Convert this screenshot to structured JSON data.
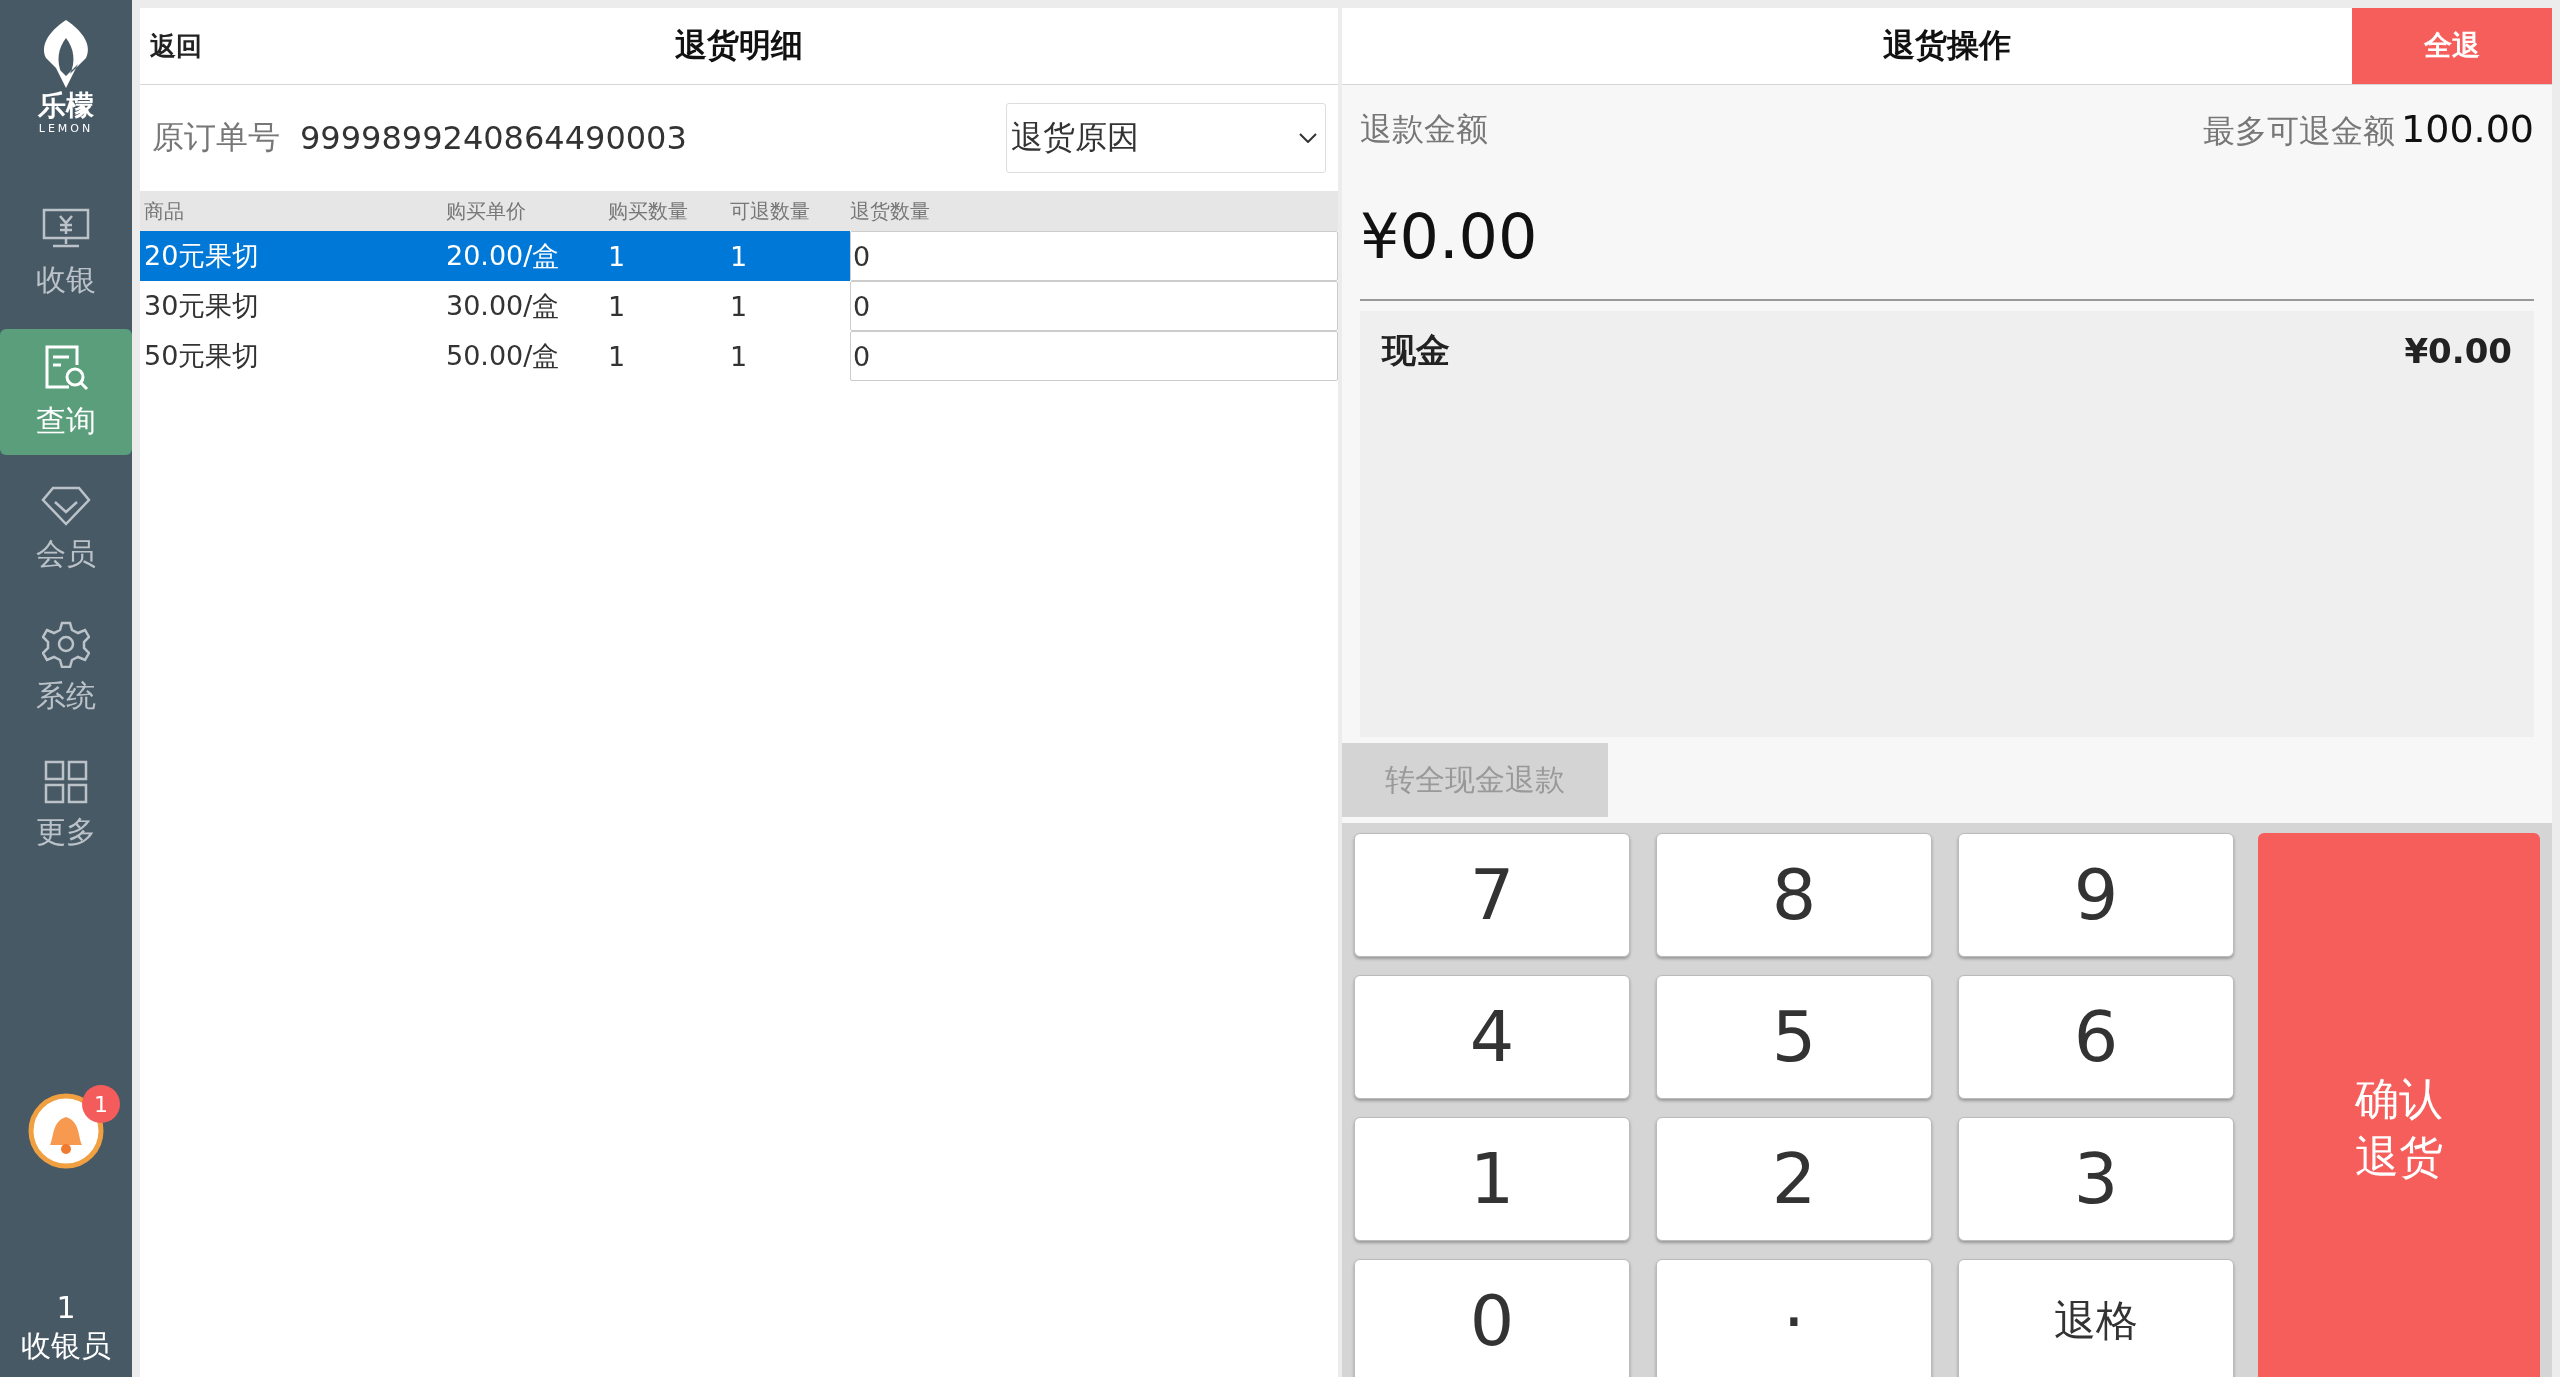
{
  "sidebar": {
    "logo": {
      "name": "乐檬",
      "sub": "LEMON"
    },
    "items": [
      {
        "label": "收银",
        "kind": "register",
        "selected": false
      },
      {
        "label": "查询",
        "kind": "query",
        "selected": true
      },
      {
        "label": "会员",
        "kind": "member",
        "selected": false
      },
      {
        "label": "系统",
        "kind": "system",
        "selected": false
      },
      {
        "label": "更多",
        "kind": "more",
        "selected": false
      }
    ],
    "notification": {
      "count": "1"
    },
    "user": {
      "id": "1",
      "role": "收银员"
    }
  },
  "detail": {
    "back": "返回",
    "title": "退货明细",
    "order_label": "原订单号",
    "order_number": "9999899240864490003",
    "reason": {
      "placeholder": "退货原因"
    },
    "columns": [
      "商品",
      "购买单价",
      "购买数量",
      "可退数量",
      "退货数量"
    ],
    "rows": [
      {
        "name": "20元果切",
        "price": "20.00/盒",
        "qty": "1",
        "returnable": "1",
        "return_qty": "0",
        "selected": true
      },
      {
        "name": "30元果切",
        "price": "30.00/盒",
        "qty": "1",
        "returnable": "1",
        "return_qty": "0",
        "selected": false
      },
      {
        "name": "50元果切",
        "price": "50.00/盒",
        "qty": "1",
        "returnable": "1",
        "return_qty": "0",
        "selected": false
      }
    ]
  },
  "operation": {
    "title": "退货操作",
    "all_button": "全退",
    "refund_label": "退款金额",
    "max_label": "最多可退金额",
    "max_value": "100.00",
    "amount": "¥0.00",
    "payments": [
      {
        "method": "现金",
        "amount": "¥0.00"
      }
    ],
    "convert_button": {
      "label": "转全现金退款",
      "disabled": true
    },
    "keys": [
      {
        "label": "7",
        "kind": "digit"
      },
      {
        "label": "8",
        "kind": "digit"
      },
      {
        "label": "9",
        "kind": "digit"
      },
      {
        "label": "4",
        "kind": "digit"
      },
      {
        "label": "5",
        "kind": "digit"
      },
      {
        "label": "6",
        "kind": "digit"
      },
      {
        "label": "1",
        "kind": "digit"
      },
      {
        "label": "2",
        "kind": "digit"
      },
      {
        "label": "3",
        "kind": "digit"
      },
      {
        "label": "0",
        "kind": "digit"
      },
      {
        "label": ".",
        "kind": "point"
      },
      {
        "label": "退格",
        "kind": "backspace"
      }
    ],
    "confirm": "确认退货"
  }
}
